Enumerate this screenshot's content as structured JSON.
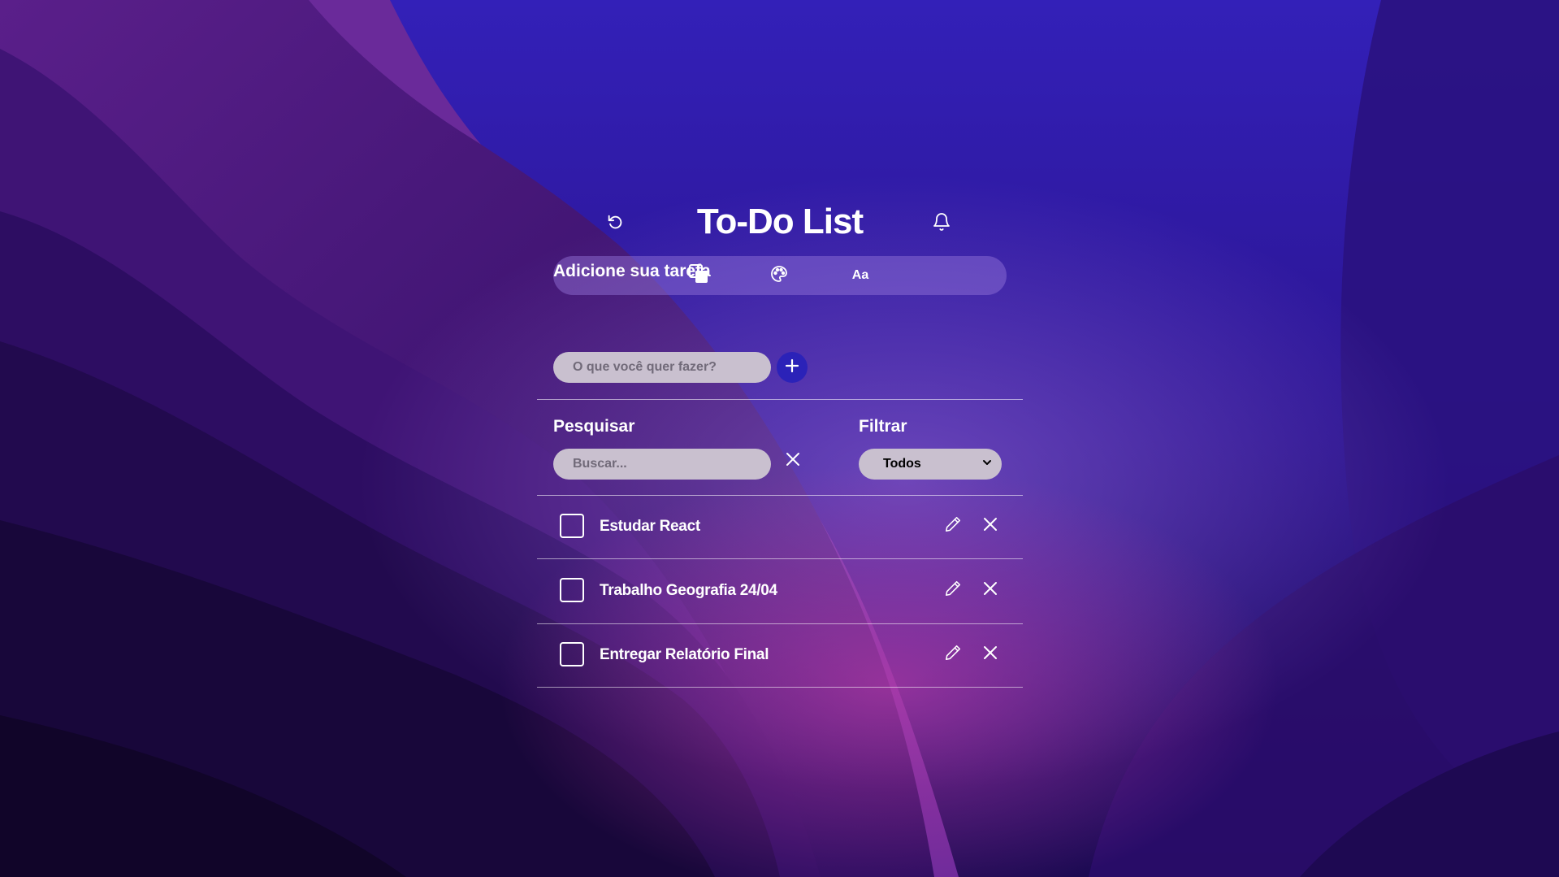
{
  "app": {
    "title": "To-Do List"
  },
  "header": {
    "reset_icon": "rotate-ccw-icon",
    "bell_icon": "bell-icon"
  },
  "toolbar": {
    "tools": [
      {
        "name": "copy-icon"
      },
      {
        "name": "palette-icon"
      },
      {
        "name": "font",
        "label": "Aa"
      }
    ]
  },
  "add_section": {
    "label": "Adicione sua tarefa",
    "placeholder": "O que você quer fazer?",
    "value": "",
    "button_icon": "plus-icon"
  },
  "search": {
    "label": "Pesquisar",
    "placeholder": "Buscar...",
    "value": "",
    "clear_icon": "close-icon"
  },
  "filter": {
    "label": "Filtrar",
    "selected": "Todos"
  },
  "tasks": [
    {
      "text": "Estudar React",
      "done": false
    },
    {
      "text": "Trabalho Geografia 24/04",
      "done": false
    },
    {
      "text": "Entregar Relatório Final",
      "done": false
    }
  ],
  "colors": {
    "add_button": "#2b22b8",
    "input_background": "#c9c0cf",
    "text": "#ffffff"
  }
}
